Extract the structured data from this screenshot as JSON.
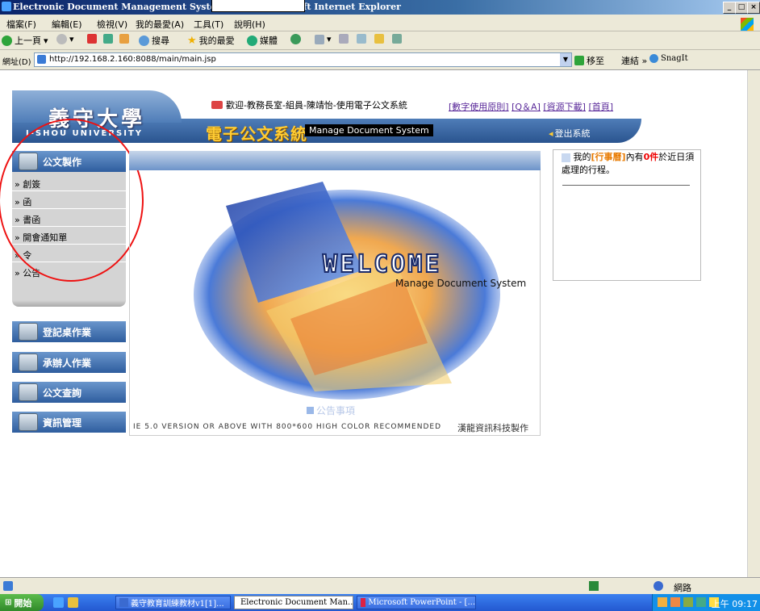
{
  "window": {
    "title": "Electronic Document Management System 1.6.4 - Microsoft Internet Explorer",
    "controls": [
      "_",
      "□",
      "×"
    ]
  },
  "menubar": [
    "檔案(F)",
    "編輯(E)",
    "檢視(V)",
    "我的最愛(A)",
    "工具(T)",
    "說明(H)"
  ],
  "toolbar": {
    "back": "上一頁",
    "search": "搜尋",
    "favorites": "我的最愛",
    "media": "媒體"
  },
  "address": {
    "label": "網址(D)",
    "url": "http://192.168.2.160:8088/main/main.jsp",
    "go": "移至",
    "links": "連結",
    "snagit": "SnagIt"
  },
  "header": {
    "university": "義守大學",
    "university_en": "I-SHOU UNIVERSITY",
    "welcome": "歡迎-教務長室-組員-陳靖怡-使用電子公文系統",
    "links": [
      "[數字使用原則]",
      "[Q＆A]",
      "[資源下載]",
      "[首頁]"
    ],
    "system_name": "電子公文系統",
    "system_name_en": "Manage Document System",
    "logout": "登出系統"
  },
  "nav": {
    "section_doc": "公文製作",
    "subitems": [
      "» 創簽",
      "» 函",
      "» 書函",
      "» 開會通知單",
      "» 令",
      "» 公告"
    ],
    "section_register": "登記桌作業",
    "section_handler": "承辦人作業",
    "section_query": "公文查詢",
    "section_info": "資訊管理"
  },
  "content": {
    "welcome": "WELCOME",
    "welcome_sub": "Manage Document System",
    "announce": "公告事項",
    "footer": "IE 5.0 VERSION OR ABOVE WITH 800*600 HIGH COLOR RECOMMENDED",
    "footer_org": "漢龍資訊科技製作"
  },
  "rightpanel": {
    "prefix": "我的",
    "schedule": "[行事曆]",
    "middle": "內有",
    "count": "0件",
    "suffix": "於近日須處理的行程。"
  },
  "statusbar": {
    "zone": "網路"
  },
  "taskbar": {
    "start": "開始",
    "tasks": [
      "義守教育訓練教材v1[1]...",
      "Electronic Document Man...",
      "Microsoft PowerPoint - [..."
    ],
    "clock": "上午 09:17"
  }
}
